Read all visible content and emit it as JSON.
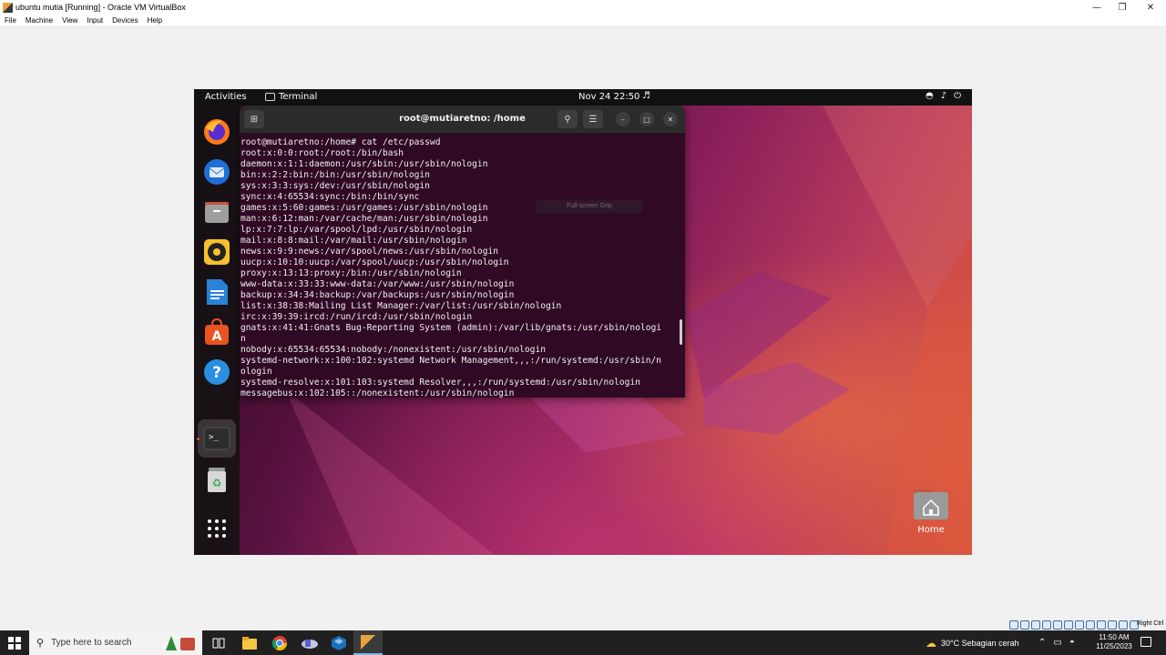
{
  "vbox": {
    "window_title": "ubuntu mutia [Running] - Oracle VM VirtualBox",
    "menu": [
      "File",
      "Machine",
      "View",
      "Input",
      "Devices",
      "Help"
    ],
    "right_ctrl": "Right Ctrl"
  },
  "gnome": {
    "activities": "Activities",
    "app_name": "Terminal",
    "clock": "Nov 24  22:50"
  },
  "terminal": {
    "title": "root@mutiaretno: /home",
    "lines": [
      "root@mutiaretno:/home# cat /etc/passwd",
      "root:x:0:0:root:/root:/bin/bash",
      "daemon:x:1:1:daemon:/usr/sbin:/usr/sbin/nologin",
      "bin:x:2:2:bin:/bin:/usr/sbin/nologin",
      "sys:x:3:3:sys:/dev:/usr/sbin/nologin",
      "sync:x:4:65534:sync:/bin:/bin/sync",
      "games:x:5:60:games:/usr/games:/usr/sbin/nologin",
      "man:x:6:12:man:/var/cache/man:/usr/sbin/nologin",
      "lp:x:7:7:lp:/var/spool/lpd:/usr/sbin/nologin",
      "mail:x:8:8:mail:/var/mail:/usr/sbin/nologin",
      "news:x:9:9:news:/var/spool/news:/usr/sbin/nologin",
      "uucp:x:10:10:uucp:/var/spool/uucp:/usr/sbin/nologin",
      "proxy:x:13:13:proxy:/bin:/usr/sbin/nologin",
      "www-data:x:33:33:www-data:/var/www:/usr/sbin/nologin",
      "backup:x:34:34:backup:/var/backups:/usr/sbin/nologin",
      "list:x:38:38:Mailing List Manager:/var/list:/usr/sbin/nologin",
      "irc:x:39:39:ircd:/run/ircd:/usr/sbin/nologin",
      "gnats:x:41:41:Gnats Bug-Reporting System (admin):/var/lib/gnats:/usr/sbin/nologi",
      "n",
      "nobody:x:65534:65534:nobody:/nonexistent:/usr/sbin/nologin",
      "systemd-network:x:100:102:systemd Network Management,,,:/run/systemd:/usr/sbin/n",
      "ologin",
      "systemd-resolve:x:101:103:systemd Resolver,,,:/run/systemd:/usr/sbin/nologin",
      "messagebus:x:102:105::/nonexistent:/usr/sbin/nologin"
    ]
  },
  "overlay_hint": "Full-screen Grip",
  "desktop": {
    "home_label": "Home"
  },
  "taskbar": {
    "search_placeholder": "Type here to search",
    "weather": "30°C  Sebagian cerah",
    "time": "11:50 AM",
    "date": "11/25/2023"
  },
  "colors": {
    "terminal_bg": "#300a24",
    "ubuntu_orange": "#e95420",
    "taskbar_bg": "#202020"
  }
}
